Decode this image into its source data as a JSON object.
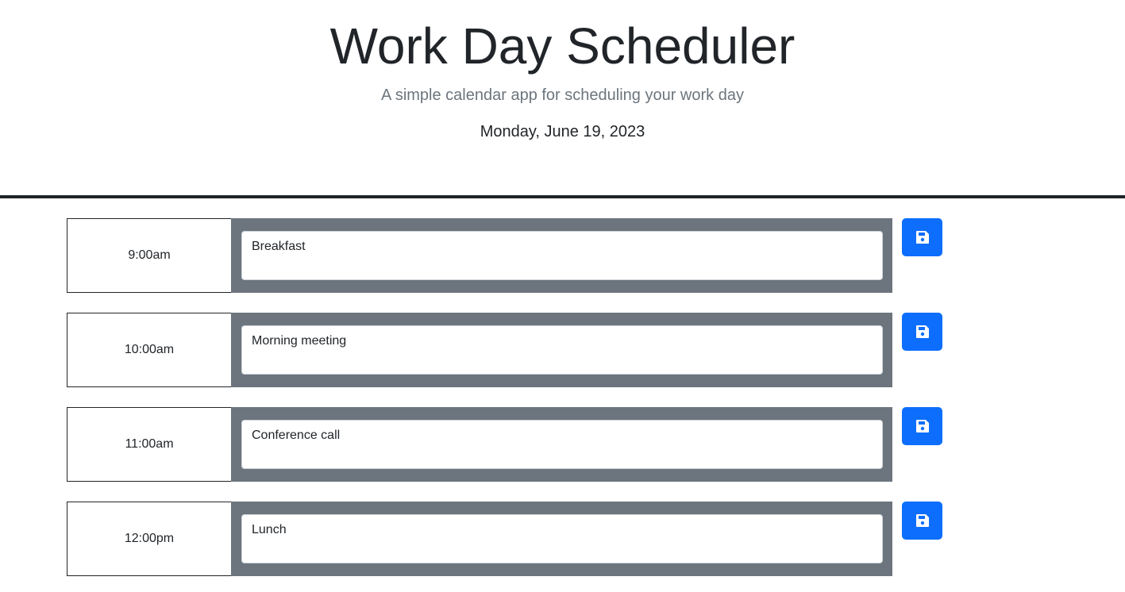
{
  "header": {
    "title": "Work Day Scheduler",
    "subtitle": "A simple calendar app for scheduling your work day",
    "date": "Monday, June 19, 2023"
  },
  "colors": {
    "slot_background": "#6c757d",
    "save_button": "#0d6efd",
    "divider": "#212529"
  },
  "rows": [
    {
      "hour": "9:00am",
      "task": "Breakfast",
      "save_icon": "floppy-disk-icon"
    },
    {
      "hour": "10:00am",
      "task": "Morning meeting",
      "save_icon": "floppy-disk-icon"
    },
    {
      "hour": "11:00am",
      "task": "Conference call",
      "save_icon": "floppy-disk-icon"
    },
    {
      "hour": "12:00pm",
      "task": "Lunch",
      "save_icon": "floppy-disk-icon"
    }
  ]
}
